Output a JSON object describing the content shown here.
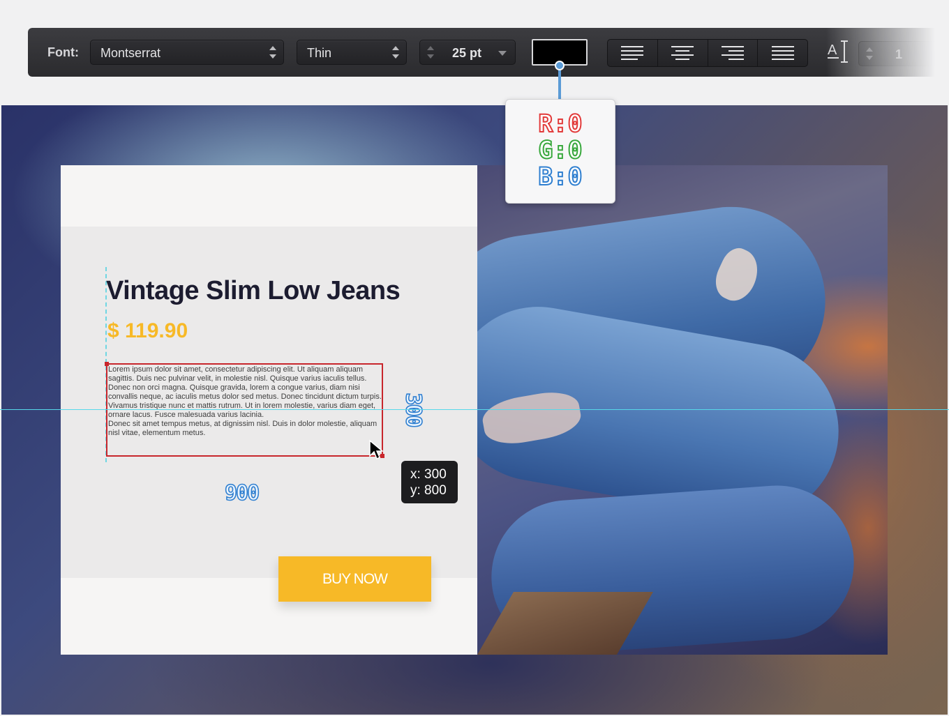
{
  "toolbar": {
    "font_label": "Font:",
    "font_family": "Montserrat",
    "font_weight": "Thin",
    "font_size": "25 pt",
    "color_hex": "#000000",
    "alignment_options": [
      "align-left",
      "align-center",
      "align-right",
      "justify"
    ],
    "spacing_value": "1"
  },
  "color_popup": {
    "r_label": "R:",
    "r_value": "0",
    "g_label": "G:",
    "g_value": "0",
    "b_label": "B:",
    "b_value": "0"
  },
  "product": {
    "title": "Vintage Slim Low Jeans",
    "price": "$ 119.90",
    "description_1": "Lorem ipsum dolor sit amet, consectetur adipiscing elit. Ut aliquam aliquam sagittis. Duis nec pulvinar velit, in molestie nisl. Quisque varius iaculis tellus. Donec non orci magna. Quisque gravida, lorem a congue varius, diam nisi convallis neque, ac iaculis metus dolor sed metus. Donec tincidunt dictum turpis. Vivamus tristique nunc et mattis rutrum. Ut in lorem molestie, varius diam eget, ornare lacus. Fusce malesuada varius lacinia.",
    "description_2": "Donec sit amet tempus metus, at dignissim nisl. Duis in dolor molestie, aliquam nisl vitae, elementum metus.",
    "buy_button": "BUY NOW",
    "accent_color": "#f7b927",
    "title_color": "#1c1c30"
  },
  "measurements": {
    "width_label": "900",
    "height_label": "300"
  },
  "cursor_tooltip": {
    "x_text": "x: 300",
    "y_text": "y: 800"
  },
  "guides_color": "#57d8ea",
  "selection_color": "#c8262c"
}
